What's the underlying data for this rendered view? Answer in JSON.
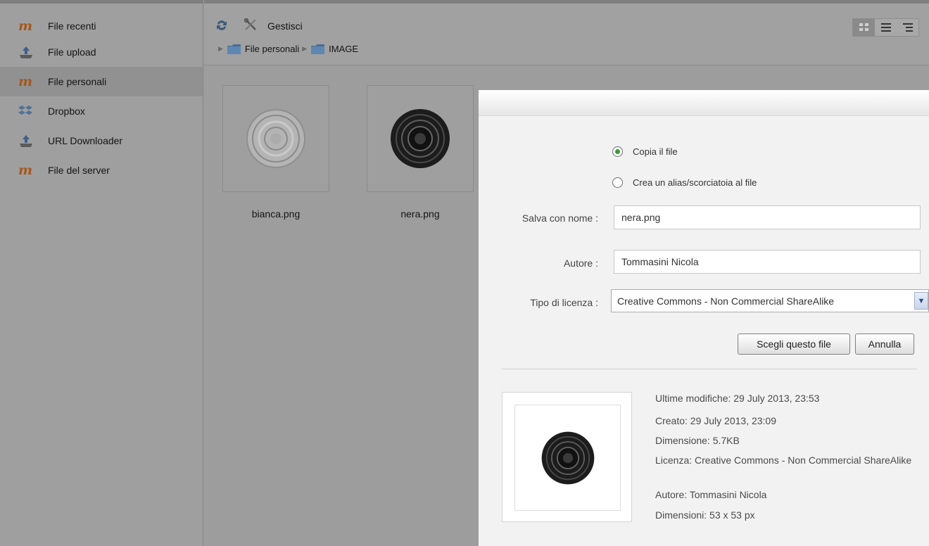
{
  "sidebar": {
    "items": [
      {
        "label": "File recenti",
        "icon": "moodle-icon"
      },
      {
        "label": "File upload",
        "icon": "upload-icon"
      },
      {
        "label": "File personali",
        "icon": "moodle-icon",
        "active": true
      },
      {
        "label": "Dropbox",
        "icon": "dropbox-icon"
      },
      {
        "label": "URL Downloader",
        "icon": "url-downloader-icon"
      },
      {
        "label": "File del server",
        "icon": "moodle-icon"
      }
    ]
  },
  "toolbar": {
    "manage_label": "Gestisci",
    "path": [
      "File personali",
      "IMAGE"
    ]
  },
  "files": [
    {
      "name": "bianca.png",
      "thumb": "white-disc"
    },
    {
      "name": "nera.png",
      "thumb": "black-disc"
    }
  ],
  "dialog": {
    "radio_copy": "Copia il file",
    "radio_alias": "Crea un alias/scorciatoia al file",
    "save_as_label": "Salva con nome :",
    "save_as_value": "nera.png",
    "author_label": "Autore :",
    "author_value": "Tommasini Nicola",
    "license_label": "Tipo di licenza :",
    "license_value": "Creative Commons - Non Commercial ShareAlike",
    "choose_button": "Scegli questo file",
    "cancel_button": "Annulla",
    "meta": {
      "modified": "Ultime modifiche: 29 July 2013, 23:53",
      "created": "Creato: 29 July 2013, 23:09",
      "size": "Dimensione: 5.7KB",
      "license": "Licenza: Creative Commons - Non Commercial ShareAlike",
      "author": "Autore: Tommasini Nicola",
      "dimensions": "Dimensioni: 53 x 53 px"
    }
  },
  "colors": {
    "moodle_orange": "#a7571a",
    "radio_green": "#3a9a3a",
    "overlay_gray": "#9d9d9d"
  }
}
